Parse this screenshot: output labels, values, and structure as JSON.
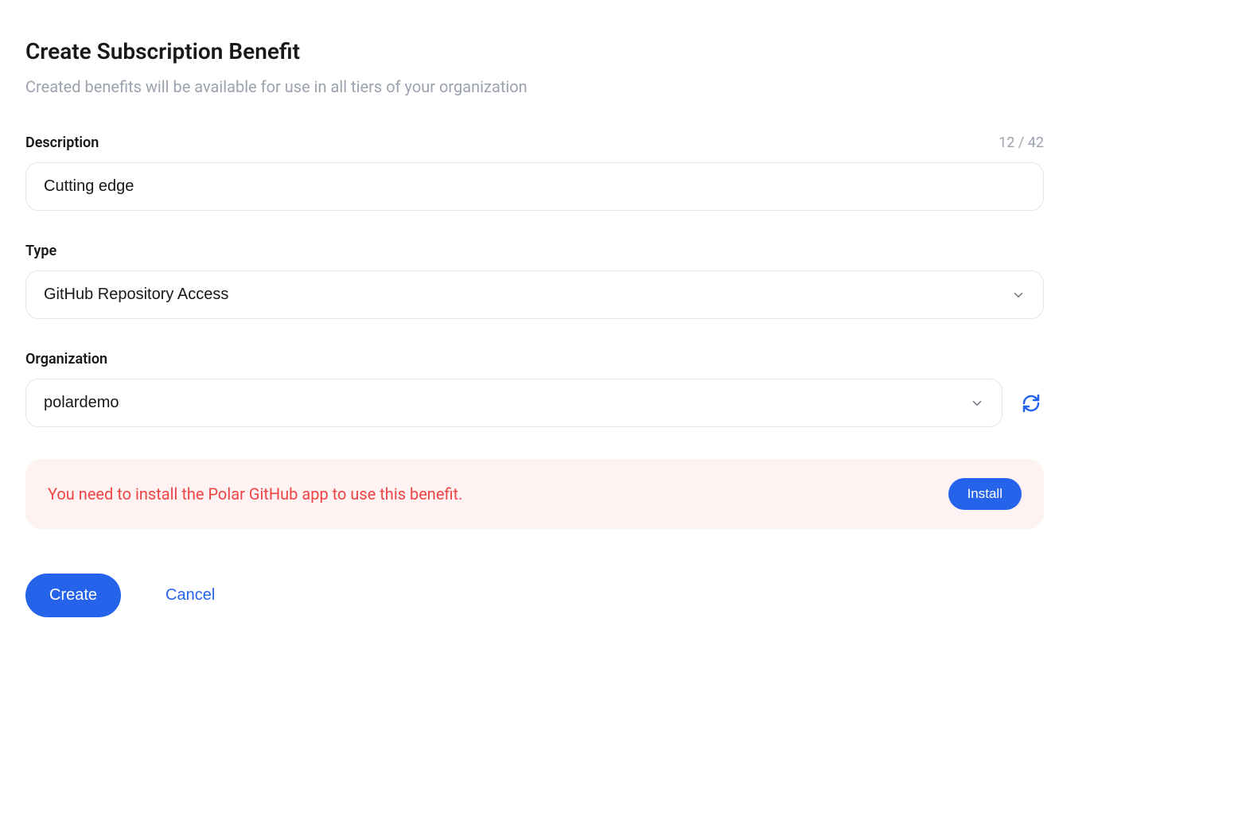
{
  "header": {
    "title": "Create Subscription Benefit",
    "subtitle": "Created benefits will be available for use in all tiers of your organization"
  },
  "description": {
    "label": "Description",
    "value": "Cutting edge",
    "char_count": "12 / 42"
  },
  "type": {
    "label": "Type",
    "selected": "GitHub Repository Access"
  },
  "organization": {
    "label": "Organization",
    "selected": "polardemo"
  },
  "alert": {
    "message": "You need to install the Polar GitHub app to use this benefit.",
    "button_label": "Install"
  },
  "actions": {
    "create_label": "Create",
    "cancel_label": "Cancel"
  }
}
